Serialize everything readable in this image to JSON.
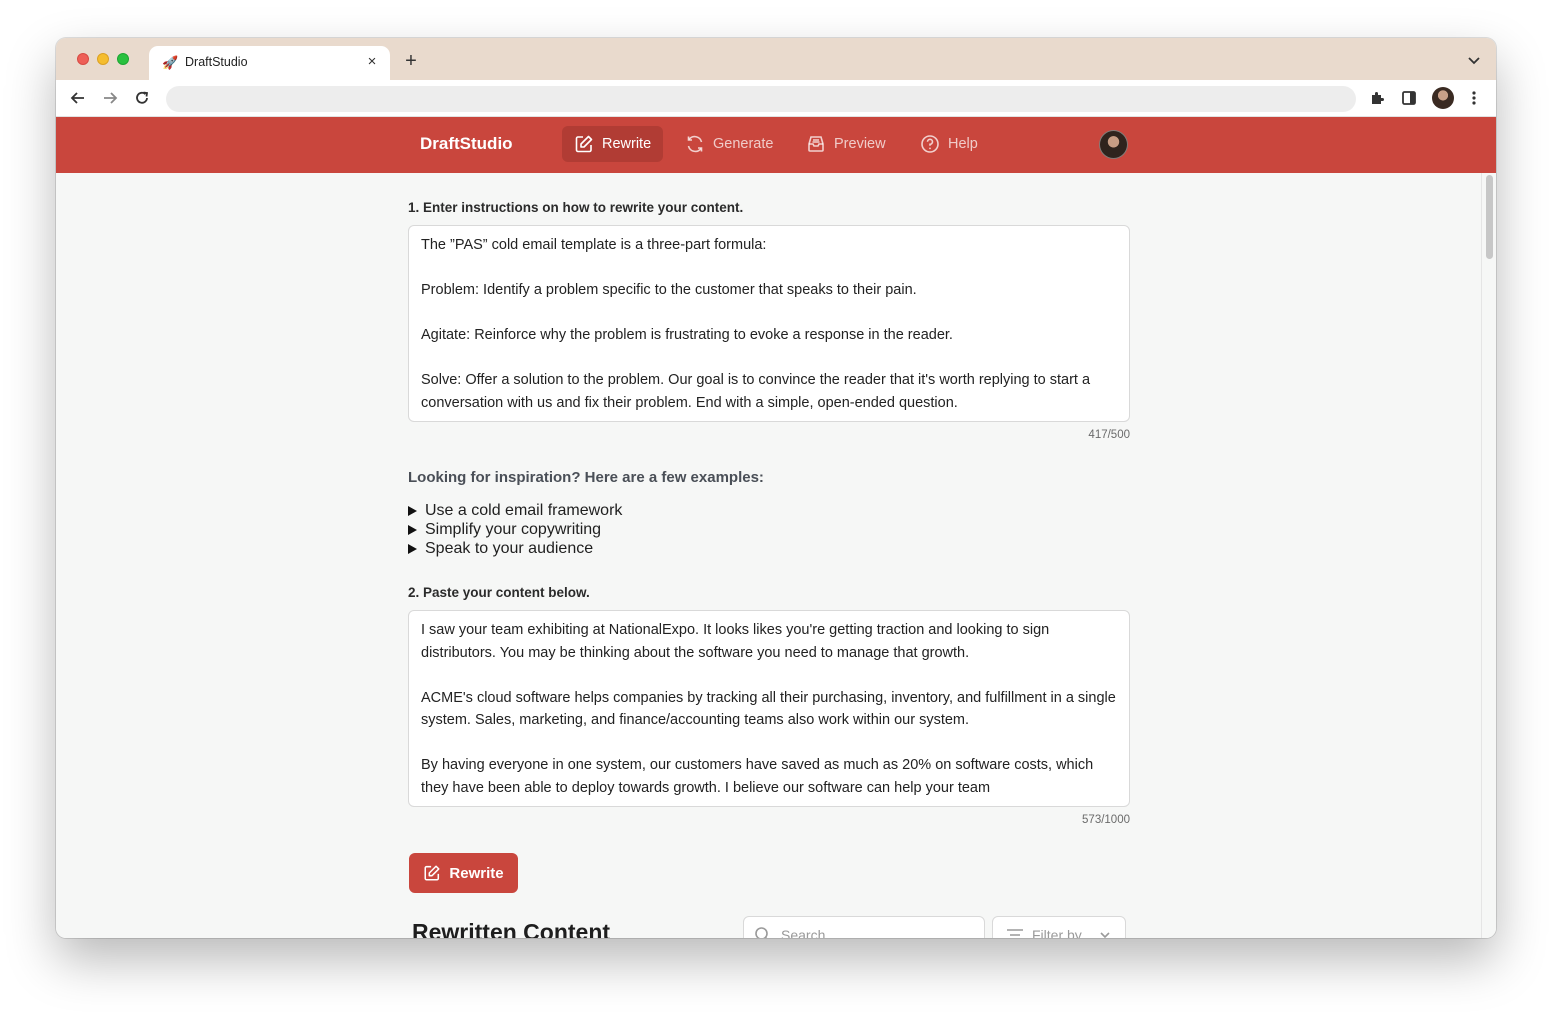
{
  "browser": {
    "tab_title": "DraftStudio",
    "favicon": "rocket-icon"
  },
  "app": {
    "brand": "DraftStudio",
    "nav": [
      {
        "label": "Rewrite",
        "icon": "edit-icon",
        "active": true
      },
      {
        "label": "Generate",
        "icon": "refresh-icon",
        "active": false
      },
      {
        "label": "Preview",
        "icon": "inbox-icon",
        "active": false
      },
      {
        "label": "Help",
        "icon": "help-circle-icon",
        "active": false
      }
    ]
  },
  "step1": {
    "label": "1. Enter instructions on how to rewrite your content.",
    "value": "The ”PAS” cold email template is a three-part formula:\n\nProblem: Identify a problem specific to the customer that speaks to their pain.\n\nAgitate: Reinforce why the problem is frustrating to evoke a response in the reader.\n\nSolve: Offer a solution to the problem. Our goal is to convince the reader that it's worth replying to start a conversation with us and fix their problem. End with a simple, open-ended question.",
    "counter": "417/500"
  },
  "inspiration": {
    "title": "Looking for inspiration? Here are a few examples:",
    "items": [
      "Use a cold email framework",
      "Simplify your copywriting",
      "Speak to your audience"
    ]
  },
  "step2": {
    "label": "2. Paste your content below.",
    "value": "I saw your team exhibiting at NationalExpo. It looks likes you're getting traction and looking to sign distributors. You may be thinking about the software you need to manage that growth.\n\nACME's cloud software helps companies by tracking all their purchasing, inventory, and fulfillment in a single system. Sales, marketing, and finance/accounting teams also work within our system.\n\nBy having everyone in one system, our customers have saved as much as 20% on software costs, which they have been able to deploy towards growth. I believe our software can help your team",
    "counter": "573/1000"
  },
  "actions": {
    "rewrite_label": "Rewrite"
  },
  "results": {
    "title": "Rewritten Content",
    "search_placeholder": "Search",
    "filter_label": "Filter by"
  },
  "colors": {
    "brand": "#c9463d",
    "brand_active": "#b13c34",
    "tabstrip": "#e9dacd"
  }
}
